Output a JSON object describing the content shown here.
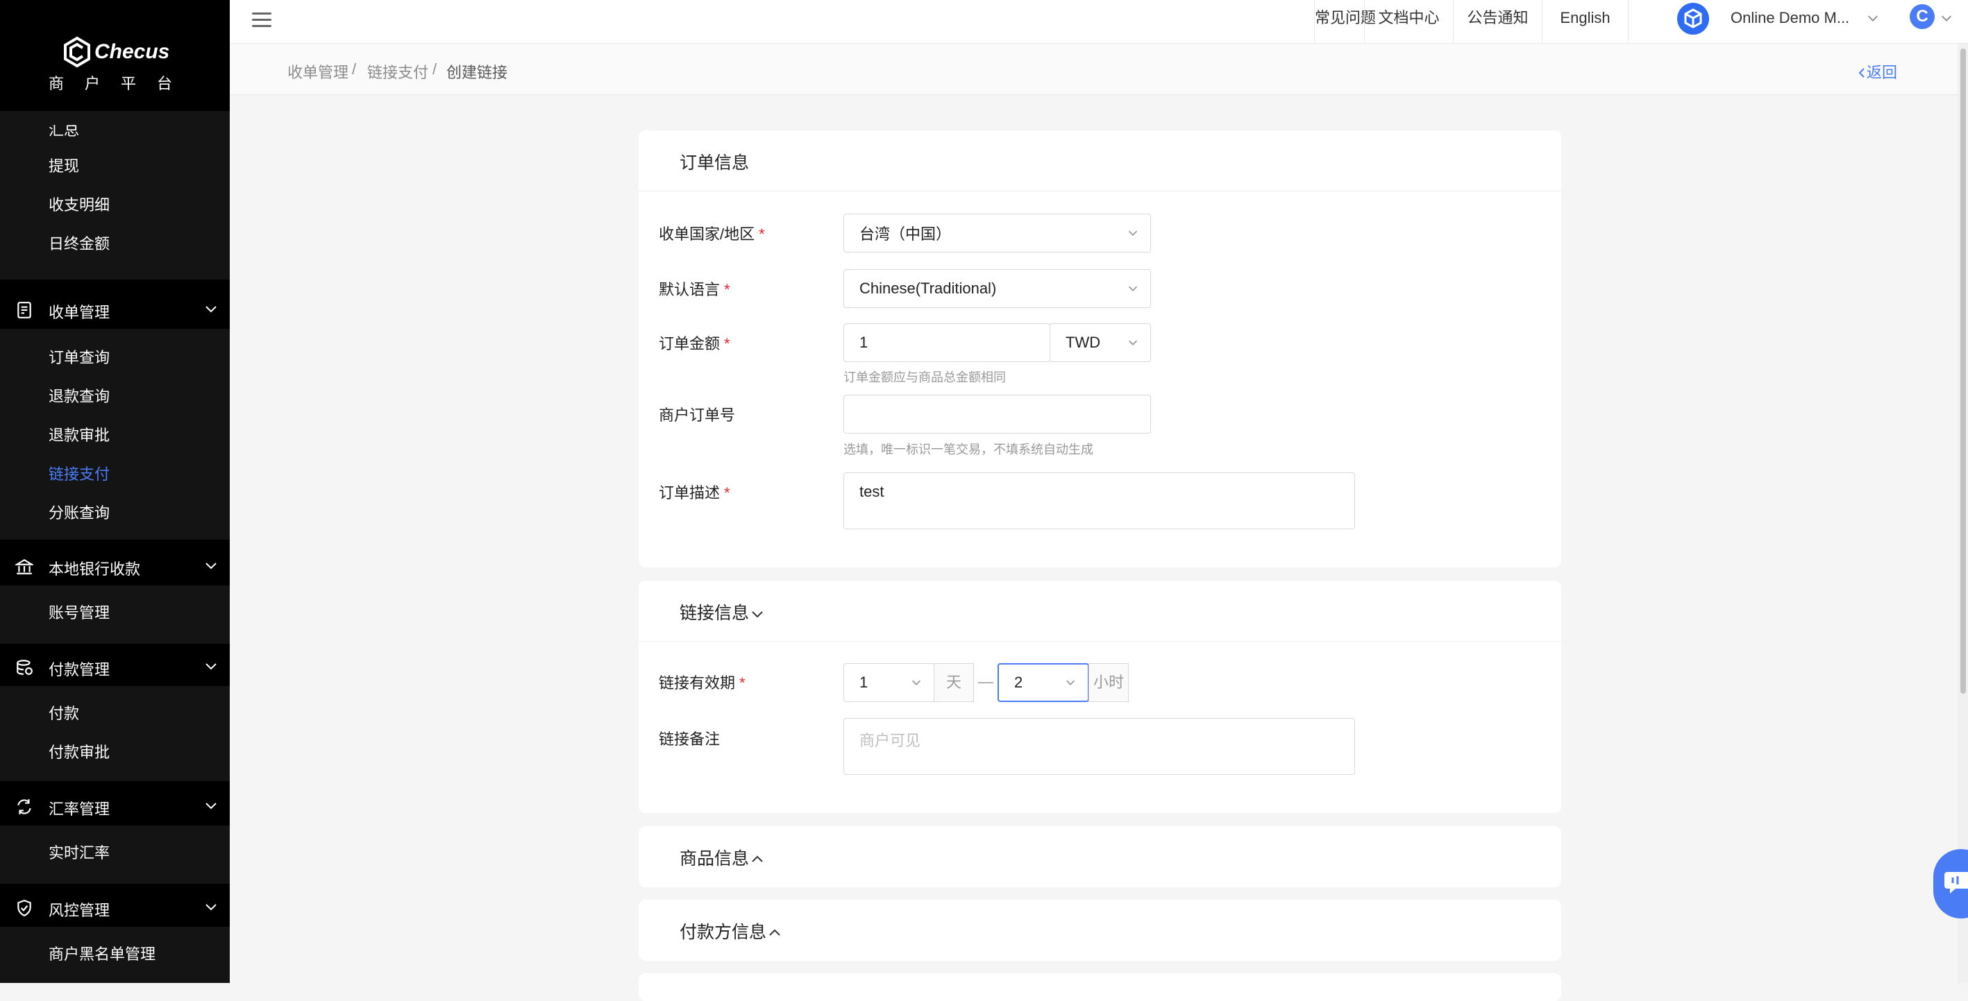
{
  "brand": {
    "name": "Checus",
    "subtitle": "商户平台"
  },
  "sidebar": {
    "cut_item": "汇总",
    "items_finance": [
      "提现",
      "收支明细",
      "日终金额"
    ],
    "groups": [
      {
        "label": "收单管理",
        "icon": "receipt-icon",
        "items": [
          "订单查询",
          "退款查询",
          "退款审批",
          "链接支付",
          "分账查询"
        ],
        "active": "链接支付"
      },
      {
        "label": "本地银行收款",
        "icon": "bank-icon",
        "items": [
          "账号管理"
        ]
      },
      {
        "label": "付款管理",
        "icon": "payment-icon",
        "items": [
          "付款",
          "付款审批"
        ]
      },
      {
        "label": "汇率管理",
        "icon": "exchange-icon",
        "items": [
          "实时汇率"
        ]
      },
      {
        "label": "风控管理",
        "icon": "shield-icon",
        "items": [
          "商户黑名单管理"
        ]
      }
    ]
  },
  "header": {
    "links": [
      "常见问题",
      "文档中心",
      "公告通知",
      "English"
    ],
    "account": "Online Demo M...",
    "user_initial": "C"
  },
  "breadcrumb": {
    "items": [
      "收单管理",
      "链接支付",
      "创建链接"
    ],
    "separator": "/",
    "back": "返回"
  },
  "order_info": {
    "title": "订单信息",
    "country_label": "收单国家/地区",
    "country_value": "台湾（中国）",
    "language_label": "默认语言",
    "language_value": "Chinese(Traditional)",
    "amount_label": "订单金额",
    "amount_value": "1",
    "currency_value": "TWD",
    "amount_hint": "订单金额应与商品总金额相同",
    "merchant_order_label": "商户订单号",
    "merchant_order_value": "",
    "merchant_order_hint": "选填，唯一标识一笔交易，不填系统自动生成",
    "desc_label": "订单描述",
    "desc_value": "test"
  },
  "link_info": {
    "title": "链接信息",
    "validity_label": "链接有效期",
    "days_value": "1",
    "days_unit": "天",
    "range_sep": "—",
    "hours_value": "2",
    "hours_unit": "小时",
    "remark_label": "链接备注",
    "remark_placeholder": "商户可见"
  },
  "product_info": {
    "title": "商品信息"
  },
  "payer_info": {
    "title": "付款方信息"
  },
  "colors": {
    "accent": "#4a7cf6",
    "sidebar_bg": "#000000",
    "required": "#f5222d"
  }
}
